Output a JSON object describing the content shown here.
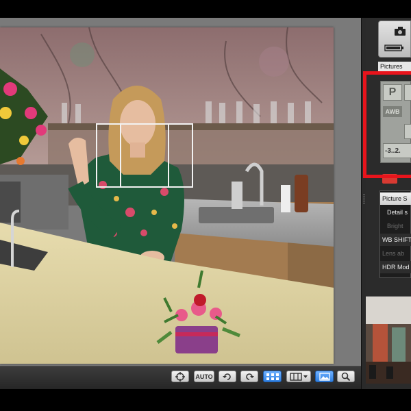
{
  "side_panel": {
    "pictures_tab": "Pictures",
    "lcd": {
      "mode": "P",
      "white_balance": "AWB",
      "exposure_scale": "-3..2."
    },
    "list": {
      "items": [
        {
          "label": "Picture S",
          "state": "header"
        },
        {
          "label": "Detail s",
          "state": "normal"
        },
        {
          "label": "Bright",
          "state": "dim"
        },
        {
          "label": "WB SHIFT",
          "state": "normal"
        },
        {
          "label": "Lens ab",
          "state": "dim"
        },
        {
          "label": "HDR Mod",
          "state": "normal"
        }
      ]
    }
  },
  "toolbar": {
    "auto_label": "AUTO",
    "buttons": [
      {
        "name": "target-icon"
      },
      {
        "name": "auto-icon"
      },
      {
        "name": "rotate-left-icon"
      },
      {
        "name": "rotate-right-icon"
      },
      {
        "name": "af-grid-icon",
        "active": true
      },
      {
        "name": "display-mode-icon"
      },
      {
        "name": "image-icon",
        "active": true
      },
      {
        "name": "zoom-icon"
      }
    ]
  },
  "colors": {
    "highlight": "#e8141c",
    "accent": "#2f7fe0"
  }
}
